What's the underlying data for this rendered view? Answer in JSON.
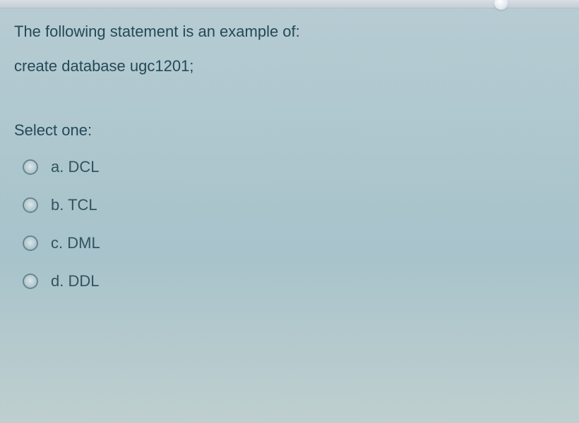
{
  "question": {
    "prompt": "The following statement is an example of:",
    "code": "create database ugc1201;",
    "select_label": "Select one:"
  },
  "options": [
    {
      "letter": "a.",
      "label": "DCL"
    },
    {
      "letter": "b.",
      "label": "TCL"
    },
    {
      "letter": "c.",
      "label": "DML"
    },
    {
      "letter": "d.",
      "label": "DDL"
    }
  ]
}
